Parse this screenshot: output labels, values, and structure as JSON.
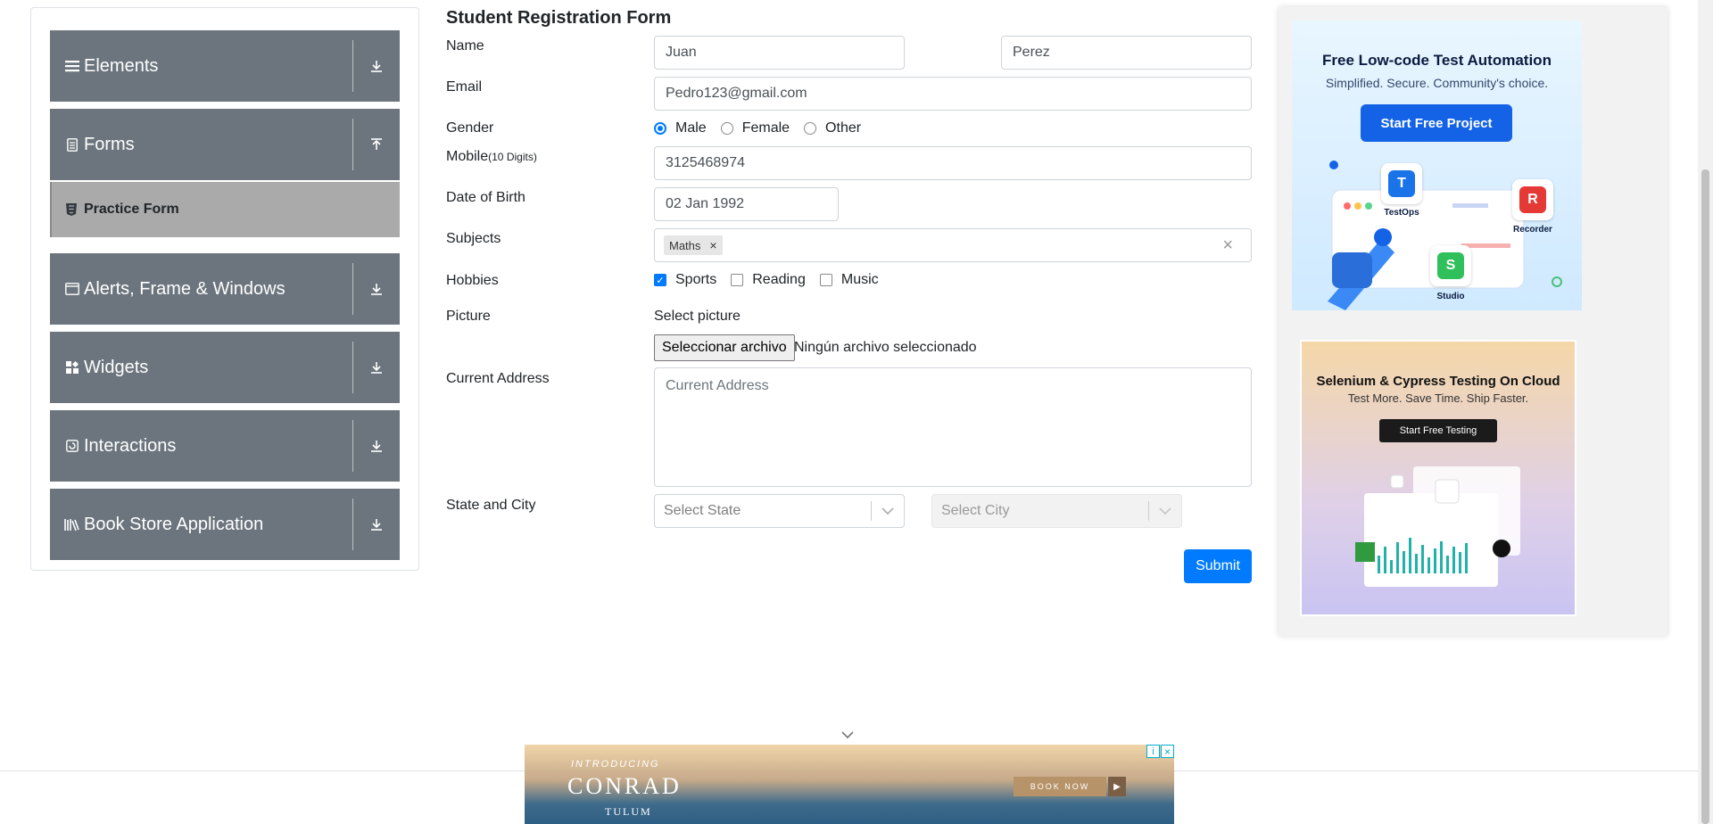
{
  "sidebar": {
    "groups": [
      {
        "label": "Elements",
        "icon": "hamburger-icon",
        "arrow": "download-icon"
      },
      {
        "label": "Forms",
        "icon": "document-icon",
        "arrow": "upload-icon"
      },
      {
        "label": "Alerts, Frame & Windows",
        "icon": "window-icon",
        "arrow": "download-icon"
      },
      {
        "label": "Widgets",
        "icon": "grid-icon",
        "arrow": "download-icon"
      },
      {
        "label": "Interactions",
        "icon": "interaction-icon",
        "arrow": "download-icon"
      },
      {
        "label": "Book Store Application",
        "icon": "books-icon",
        "arrow": "download-icon"
      }
    ],
    "active_item": {
      "label": "Practice Form",
      "icon": "html5-icon"
    }
  },
  "form": {
    "title": "Student Registration Form",
    "name": {
      "label": "Name",
      "first": "Juan",
      "last": "Perez"
    },
    "email": {
      "label": "Email",
      "value": "Pedro123@gmail.com"
    },
    "gender": {
      "label": "Gender",
      "options": [
        "Male",
        "Female",
        "Other"
      ],
      "selected": "Male"
    },
    "mobile": {
      "label": "Mobile",
      "hint": "(10 Digits)",
      "value": "3125468974"
    },
    "dob": {
      "label": "Date of Birth",
      "value": "02 Jan 1992"
    },
    "subjects": {
      "label": "Subjects",
      "chips": [
        "Maths"
      ],
      "clear": "×"
    },
    "hobbies": {
      "label": "Hobbies",
      "options": [
        "Sports",
        "Reading",
        "Music"
      ],
      "checked": [
        "Sports"
      ]
    },
    "picture": {
      "label": "Picture",
      "prompt": "Select picture",
      "button": "Seleccionar archivo",
      "status": "Ningún archivo seleccionado"
    },
    "address": {
      "label": "Current Address",
      "placeholder": "Current Address"
    },
    "state_city": {
      "label": "State and City",
      "state_placeholder": "Select State",
      "city_placeholder": "Select City"
    },
    "submit": "Submit"
  },
  "ads": {
    "top": {
      "headline": "Free Low-code Test Automation",
      "sub": "Simplified. Secure. Community's choice.",
      "cta": "Start Free Project",
      "products": [
        "TestOps",
        "Recorder",
        "Studio"
      ]
    },
    "second": {
      "headline": "Selenium & Cypress Testing On Cloud",
      "sub": "Test More. Save Time. Ship Faster.",
      "cta": "Start Free Testing"
    },
    "bottom": {
      "intro": "INTRODUCING",
      "brand": "CONRAD",
      "location": "TULUM",
      "cta": "BOOK NOW"
    }
  },
  "colors": {
    "sidebar_bg": "#6c757d",
    "active_bg": "#aaaaaa",
    "primary": "#007bff"
  }
}
